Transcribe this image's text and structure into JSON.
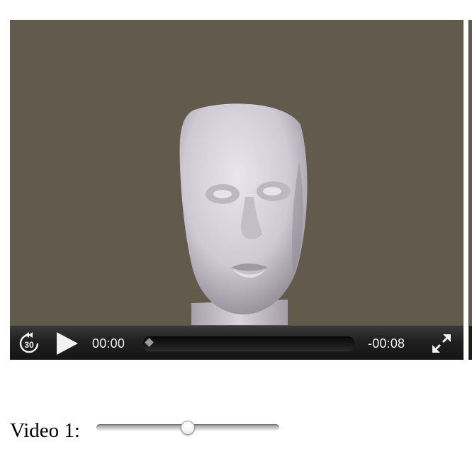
{
  "player": {
    "time_elapsed": "00:00",
    "time_remaining": "-00:08",
    "skip_back_seconds": "30",
    "playback_progress": 0,
    "state": "paused"
  },
  "slider": {
    "label": "Video 1:",
    "value_fraction": 0.5
  },
  "colors": {
    "video_background": "#625a4d",
    "controls_background": "#1c1c1c",
    "control_foreground": "#f2f2f2"
  },
  "icons": {
    "skip_back": "skip-back-30-icon",
    "play": "play-icon",
    "fullscreen": "fullscreen-icon"
  }
}
